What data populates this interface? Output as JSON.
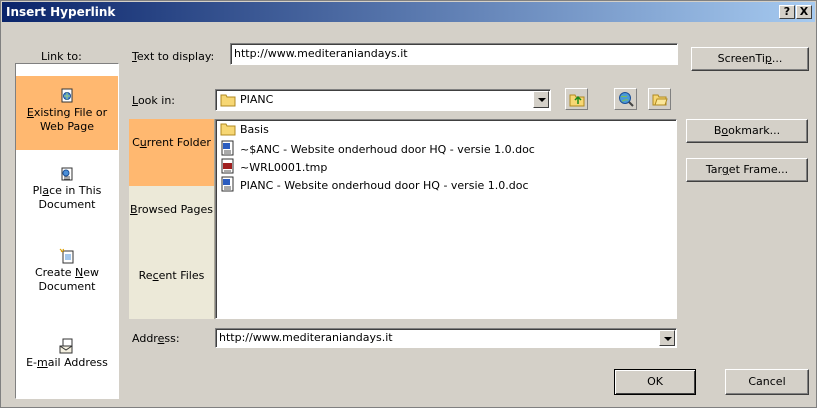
{
  "window": {
    "title": "Insert Hyperlink",
    "help_label": "?",
    "close_label": "X"
  },
  "link_to": {
    "label": "Link to:",
    "items": [
      {
        "label_pre": "",
        "label_key": "E",
        "label_post": "xisting File or Web Page",
        "icon": "existing-file-icon",
        "active": true
      },
      {
        "label_pre": "Pl",
        "label_key": "a",
        "label_post": "ce in This Document",
        "icon": "place-in-document-icon",
        "active": false
      },
      {
        "label_pre": "Create ",
        "label_key": "N",
        "label_post": "ew Document",
        "icon": "new-document-icon",
        "active": false
      },
      {
        "label_pre": "E-",
        "label_key": "m",
        "label_post": "ail Address",
        "icon": "email-icon",
        "active": false
      }
    ]
  },
  "text_to_display": {
    "label_pre": "",
    "label_key": "T",
    "label_post": "ext to display:",
    "value": "http://www.mediteraniandays.it"
  },
  "screentip": {
    "label_pre": "ScreenTi",
    "label_key": "p",
    "label_post": "..."
  },
  "look_in": {
    "label_pre": "",
    "label_key": "L",
    "label_post": "ook in:",
    "value": "PIANC"
  },
  "nav": [
    {
      "label_pre": "C",
      "label_key": "u",
      "label_post": "rrent Folder",
      "active": true
    },
    {
      "label_pre": "",
      "label_key": "B",
      "label_post": "rowsed Pages",
      "active": false
    },
    {
      "label_pre": "Re",
      "label_key": "c",
      "label_post": "ent Files",
      "active": false
    }
  ],
  "files": [
    {
      "name": "Basis",
      "icon": "folder-icon"
    },
    {
      "name": "~$ANC - Website onderhoud door HQ - versie 1.0.doc",
      "icon": "word-doc-icon"
    },
    {
      "name": "~WRL0001.tmp",
      "icon": "tmp-file-icon"
    },
    {
      "name": "PIANC - Website onderhoud door HQ - versie 1.0.doc",
      "icon": "word-doc-icon"
    }
  ],
  "bookmark": {
    "label_pre": "B",
    "label_key": "o",
    "label_post": "okmark..."
  },
  "target_frame": {
    "label_pre": "Tar",
    "label_key": "g",
    "label_post": "et Frame..."
  },
  "address": {
    "label_pre": "Addr",
    "label_key": "e",
    "label_post": "ss:",
    "value": "http://www.mediteraniandays.it"
  },
  "ok": "OK",
  "cancel": "Cancel",
  "colors": {
    "title_start": "#0a246a",
    "title_end": "#a6caf0",
    "face": "#d4d0c8",
    "selection": "#ffb870"
  }
}
